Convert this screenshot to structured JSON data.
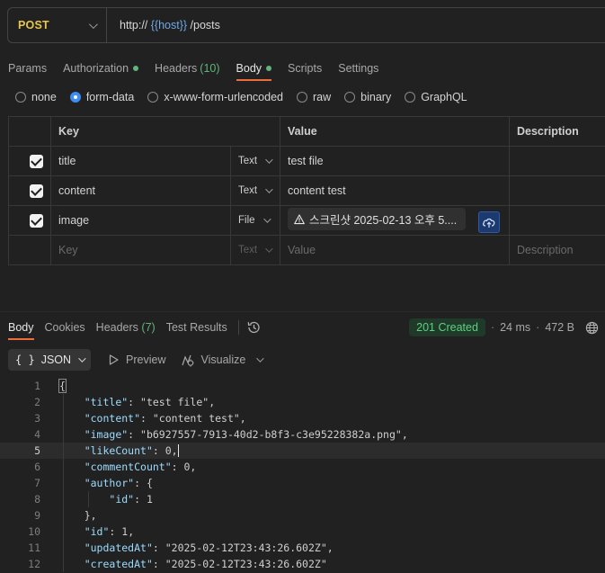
{
  "request": {
    "method": "POST",
    "url_prefix": "http:// ",
    "url_var": "{{host}}",
    "url_suffix": " /posts"
  },
  "req_tabs": [
    {
      "label": "Params"
    },
    {
      "label": "Authorization",
      "dot": true
    },
    {
      "label": "Headers",
      "count": "(10)"
    },
    {
      "label": "Body",
      "dot": true,
      "active": true
    },
    {
      "label": "Scripts"
    },
    {
      "label": "Settings"
    }
  ],
  "body_types": [
    "none",
    "form-data",
    "x-www-form-urlencoded",
    "raw",
    "binary",
    "GraphQL"
  ],
  "body_type_selected": "form-data",
  "table": {
    "headers": {
      "key": "Key",
      "value": "Value",
      "description": "Description"
    },
    "rows": [
      {
        "key": "title",
        "type": "Text",
        "value": "test file"
      },
      {
        "key": "content",
        "type": "Text",
        "value": "content test"
      },
      {
        "key": "image",
        "type": "File",
        "file": "스크린샷 2025-02-13 오후 5...."
      }
    ],
    "placeholder": {
      "key": "Key",
      "type": "Text",
      "value": "Value",
      "description": "Description"
    }
  },
  "response": {
    "tabs": {
      "body": "Body",
      "cookies": "Cookies",
      "headers": "Headers",
      "headers_count": "(7)",
      "test_results": "Test Results"
    },
    "status": "201 Created",
    "time": "24 ms",
    "size": "472 B",
    "format": "JSON",
    "preview": "Preview",
    "visualize": "Visualize"
  },
  "json_lines": [
    {
      "n": "1",
      "t": "{"
    },
    {
      "n": "2",
      "t": "    \"title\": \"test file\","
    },
    {
      "n": "3",
      "t": "    \"content\": \"content test\","
    },
    {
      "n": "4",
      "t": "    \"image\": \"b6927557-7913-40d2-b8f3-c3e95228382a.png\","
    },
    {
      "n": "5",
      "t": "    \"likeCount\": 0,",
      "current": true
    },
    {
      "n": "6",
      "t": "    \"commentCount\": 0,"
    },
    {
      "n": "7",
      "t": "    \"author\": {"
    },
    {
      "n": "8",
      "t": "        \"id\": 1"
    },
    {
      "n": "9",
      "t": "    },"
    },
    {
      "n": "10",
      "t": "    \"id\": 1,"
    },
    {
      "n": "11",
      "t": "    \"updatedAt\": \"2025-02-12T23:43:26.602Z\","
    },
    {
      "n": "12",
      "t": "    \"createdAt\": \"2025-02-12T23:43:26.602Z\""
    }
  ],
  "colors": {
    "accent": "#f06b3a",
    "method": "#e8c64a",
    "status_green": "#5fcf83",
    "link_blue": "#3d8df2"
  },
  "icons": [
    "chevron-down-icon",
    "warning-icon",
    "cloud-upload-icon",
    "history-icon",
    "globe-icon",
    "play-icon",
    "visualize-icon"
  ]
}
